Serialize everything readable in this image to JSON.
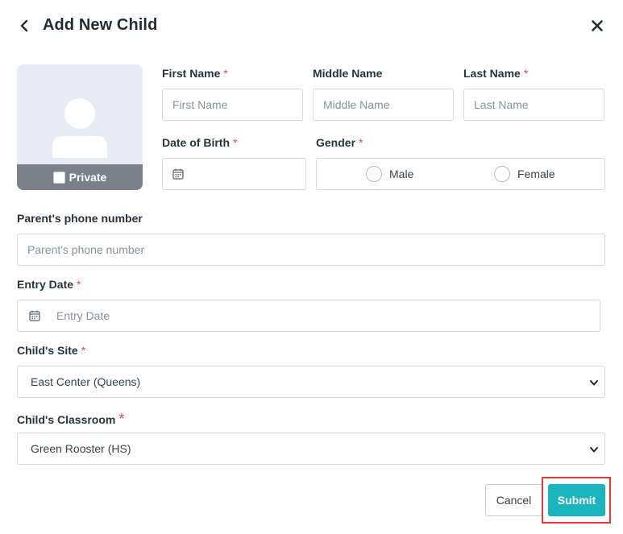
{
  "header": {
    "title": "Add New Child",
    "back_icon": "chevron-left-icon",
    "close_icon": "close-icon"
  },
  "avatar": {
    "placeholder_icon": "person-placeholder-icon",
    "private_label": "Private",
    "private_checked": false
  },
  "fields": {
    "first_name": {
      "label": "First Name",
      "required": "*",
      "placeholder": "First Name",
      "value": ""
    },
    "middle_name": {
      "label": "Middle Name",
      "placeholder": "Middle Name",
      "value": ""
    },
    "last_name": {
      "label": "Last Name",
      "required": "*",
      "placeholder": "Last Name",
      "value": ""
    },
    "dob": {
      "label": "Date of Birth",
      "required": "*",
      "value": "",
      "icon": "calendar-icon"
    },
    "gender": {
      "label": "Gender",
      "required": "*",
      "options": [
        "Male",
        "Female"
      ],
      "selected": ""
    },
    "parent_phone": {
      "label": "Parent's phone number",
      "placeholder": "Parent's phone number",
      "value": ""
    },
    "entry_date": {
      "label": "Entry Date",
      "required": "*",
      "placeholder": "Entry Date",
      "icon": "calendar-icon"
    },
    "site": {
      "label": "Child's Site",
      "required": "*",
      "value": "East Center (Queens)"
    },
    "classroom": {
      "label": "Child's Classroom",
      "required": "*",
      "value": "Green Rooster (HS)"
    }
  },
  "actions": {
    "cancel_label": "Cancel",
    "submit_label": "Submit",
    "submit_color": "#19b4bd",
    "highlight_color": "#e53935"
  }
}
